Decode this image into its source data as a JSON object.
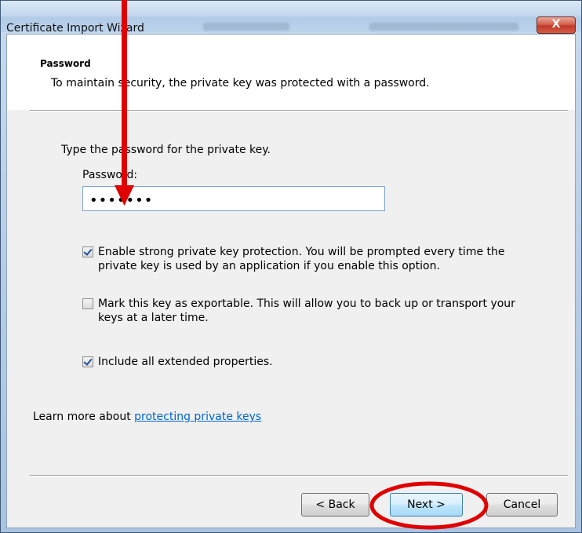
{
  "window": {
    "title": "Certificate Import Wizard",
    "close_glyph": "X"
  },
  "header": {
    "title": "Password",
    "subtitle": "To maintain security, the private key was protected with a password."
  },
  "body": {
    "instruction": "Type the password for the private key.",
    "password_label": "Password:",
    "password_value": "•••••••"
  },
  "options": [
    {
      "checked": true,
      "lines": [
        "Enable strong private key protection. You will be prompted every time the",
        "private key is used by an application if you enable this option."
      ]
    },
    {
      "checked": false,
      "lines": [
        "Mark this key as exportable. This will allow you to back up or transport your",
        "keys at a later time."
      ]
    },
    {
      "checked": true,
      "lines": [
        "Include all extended properties."
      ]
    }
  ],
  "learn_more": {
    "prefix": "Learn more about ",
    "link_text": "protecting private keys"
  },
  "buttons": {
    "back": "< Back",
    "next": "Next >",
    "cancel": "Cancel"
  },
  "annotations": {
    "arrow_color": "#e00000",
    "circle_color": "#e00000"
  }
}
